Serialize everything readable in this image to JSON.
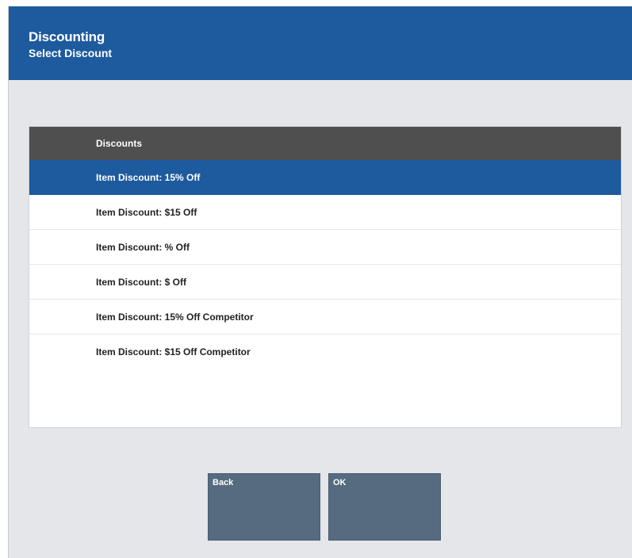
{
  "header": {
    "title": "Discounting",
    "subtitle": "Select Discount"
  },
  "list": {
    "column_header": "Discounts",
    "selected_index": 0,
    "items": [
      {
        "label": "Item Discount: 15% Off"
      },
      {
        "label": "Item Discount: $15 Off"
      },
      {
        "label": "Item Discount: % Off"
      },
      {
        "label": "Item Discount: $ Off"
      },
      {
        "label": "Item Discount: 15% Off Competitor"
      },
      {
        "label": "Item Discount: $15 Off Competitor"
      }
    ]
  },
  "buttons": {
    "back_label": "Back",
    "ok_label": "OK"
  },
  "colors": {
    "header_bg": "#1e5a9e",
    "selected_row_bg": "#1e5a9e",
    "list_header_bg": "#4f4f4f",
    "button_bg": "#566b80",
    "screen_bg": "#e4e6ea"
  }
}
